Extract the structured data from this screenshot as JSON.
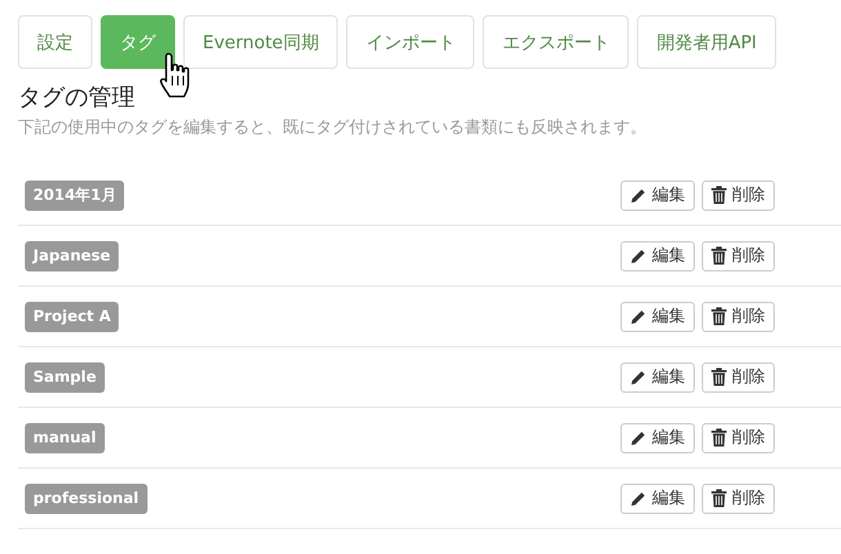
{
  "tabs": [
    {
      "label": "設定",
      "selected": false
    },
    {
      "label": "タグ",
      "selected": true
    },
    {
      "label": "Evernote同期",
      "selected": false
    },
    {
      "label": "インポート",
      "selected": false
    },
    {
      "label": "エクスポート",
      "selected": false
    },
    {
      "label": "開発者用API",
      "selected": false
    }
  ],
  "section": {
    "title": "タグの管理",
    "description": "下記の使用中のタグを編集すると、既にタグ付けされている書類にも反映されます。"
  },
  "tags": [
    {
      "name": "2014年1月",
      "edit": "編集",
      "delete": "削除"
    },
    {
      "name": "Japanese",
      "edit": "編集",
      "delete": "削除"
    },
    {
      "name": "Project A",
      "edit": "編集",
      "delete": "削除"
    },
    {
      "name": "Sample",
      "edit": "編集",
      "delete": "削除"
    },
    {
      "name": "manual",
      "edit": "編集",
      "delete": "削除"
    },
    {
      "name": "professional",
      "edit": "編集",
      "delete": "削除"
    }
  ]
}
